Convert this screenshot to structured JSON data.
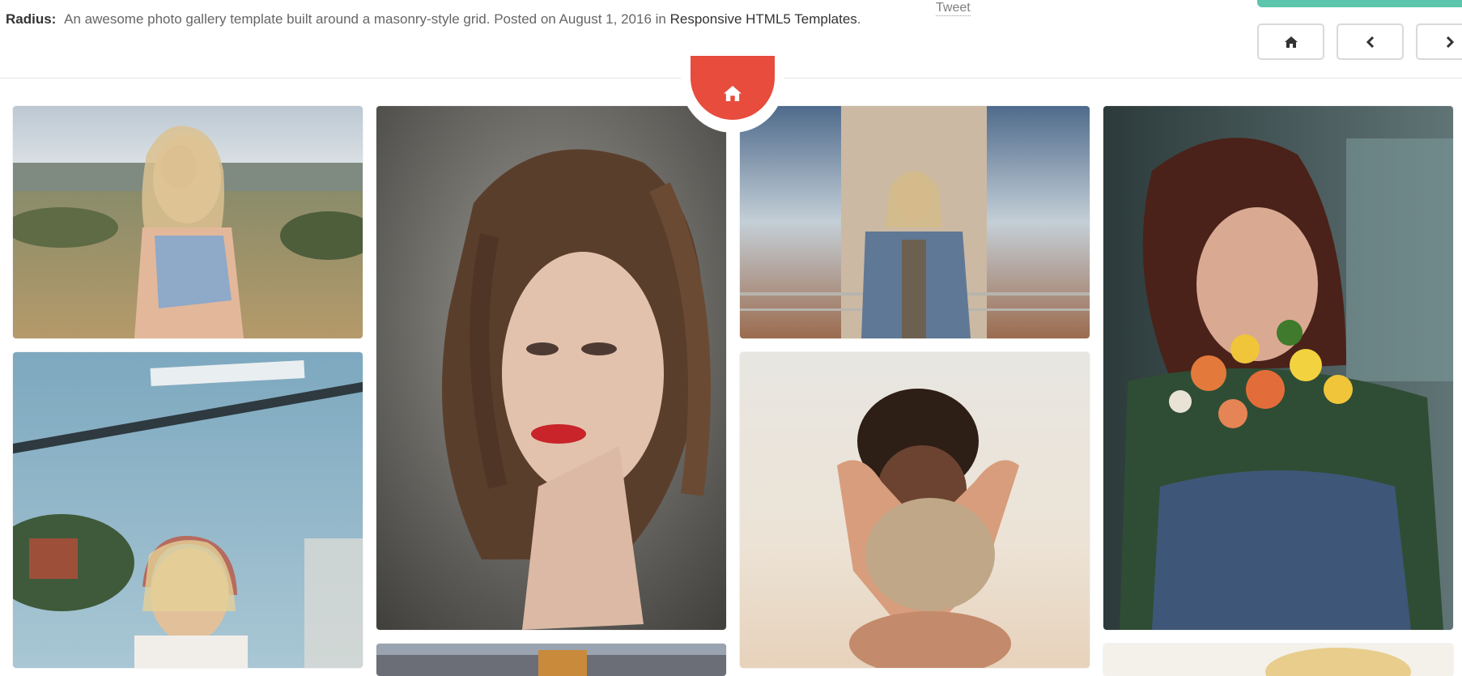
{
  "header": {
    "template_name": "Radius:",
    "description_prefix": "An awesome photo gallery template built around a masonry-style grid. Posted on August 1, 2016 in",
    "category_link": "Responsive HTML5 Templates",
    "description_suffix": ".",
    "tweet_label": "Tweet"
  },
  "nav": {
    "home_icon": "home-icon",
    "prev_icon": "chevron-left-icon",
    "next_icon": "chevron-right-icon"
  },
  "home_badge": {
    "icon": "home-icon",
    "color": "#e74c3c"
  },
  "accent_color": "#5cc6ad",
  "gallery": {
    "photos": [
      {
        "id": "photo-blonde-field",
        "subject": "blonde woman in blue top on field"
      },
      {
        "id": "photo-headphones",
        "subject": "blonde girl with headphones"
      },
      {
        "id": "photo-red-lips-portrait",
        "subject": "woman with red lips portrait"
      },
      {
        "id": "photo-bottom-partial-2",
        "subject": "partial photo"
      },
      {
        "id": "photo-denim-jacket",
        "subject": "woman in denim jacket with sunglasses"
      },
      {
        "id": "photo-hands-sand",
        "subject": "hands holding sand"
      },
      {
        "id": "photo-flowers",
        "subject": "woman smelling flowers"
      },
      {
        "id": "photo-bottom-partial-4",
        "subject": "partial photo"
      }
    ]
  }
}
